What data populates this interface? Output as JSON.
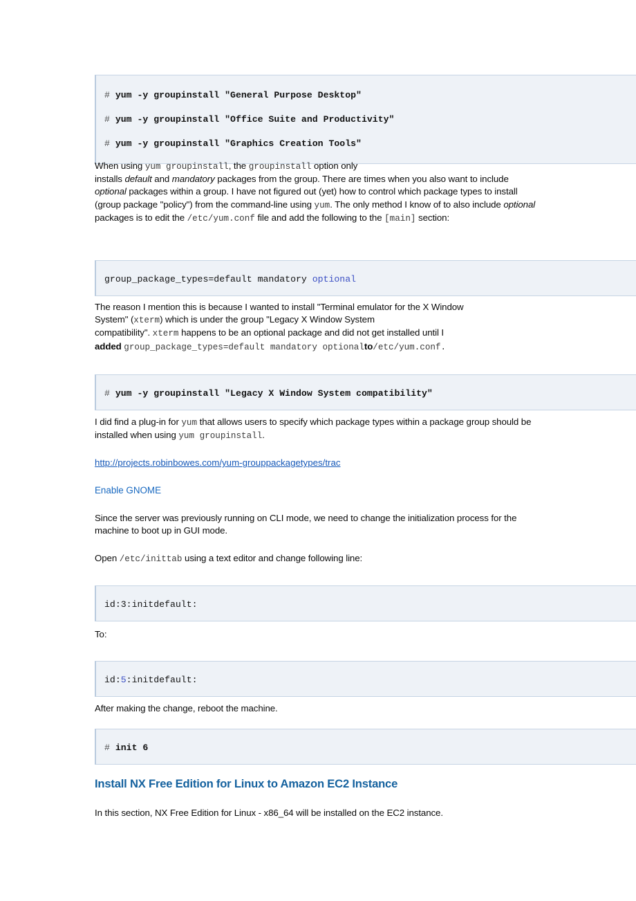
{
  "document": {
    "blocks": [
      {
        "kind": "code-block-commands",
        "lines": [
          {
            "prompt": "#",
            "command": "yum -y groupinstall \"General Purpose Desktop\""
          },
          {
            "prompt": "#",
            "command": "yum -y groupinstall \"Office Suite and Productivity\""
          },
          {
            "prompt": "#",
            "command": "yum -y groupinstall \"Graphics Creation Tools\""
          }
        ]
      },
      {
        "kind": "paragraph",
        "id": "para_groupinstall",
        "segments": [
          {
            "type": "text",
            "text": "When using "
          },
          {
            "type": "code",
            "text": "yum groupinstall"
          },
          {
            "type": "text",
            "text": ", the "
          },
          {
            "type": "code",
            "text": "groupinstall"
          },
          {
            "type": "text",
            "text": " option only"
          },
          {
            "type": "break"
          },
          {
            "type": "text",
            "text": "installs "
          },
          {
            "type": "italic",
            "text": "default"
          },
          {
            "type": "text",
            "text": " and "
          },
          {
            "type": "italic",
            "text": "mandatory"
          },
          {
            "type": "text",
            "text": " packages from the group. There are times when you also want to include "
          },
          {
            "type": "italic",
            "text": "optional"
          },
          {
            "type": "text",
            "text": " packages within a group. I have not figured out (yet) how to control which package types to install (group package \"policy\") from the command-line using "
          },
          {
            "type": "code",
            "text": "yum"
          },
          {
            "type": "text",
            "text": ". The only method I know of to also include "
          },
          {
            "type": "italic",
            "text": "optional"
          },
          {
            "type": "text",
            "text": " packages is to edit the "
          },
          {
            "type": "code",
            "text": "/etc/yum.conf"
          },
          {
            "type": "text",
            "text": " file and add the following to the "
          },
          {
            "type": "code",
            "text": "[main]"
          },
          {
            "type": "text",
            "text": " section:"
          }
        ]
      },
      {
        "kind": "code-block-config",
        "id": "code_group_package_types",
        "plain_prefix": "group_package_types=default mandatory ",
        "highlight": "optional",
        "highlight_color": "#3b4fc4"
      },
      {
        "kind": "paragraph",
        "id": "para_xterm",
        "segments": [
          {
            "type": "text",
            "text": "The reason I mention this is because I wanted to install \"Terminal emulator for the X Window System\" ("
          },
          {
            "type": "code",
            "text": "xterm"
          },
          {
            "type": "text",
            "text": ") which is under the group \"Legacy X Window System"
          },
          {
            "type": "break"
          },
          {
            "type": "text",
            "text": "compatibility\". "
          },
          {
            "type": "code",
            "text": "xterm"
          },
          {
            "type": "text",
            "text": " happens to be an optional package and did not get installed until I added "
          },
          {
            "type": "code",
            "text": "group_package_types=default mandatory optional"
          },
          {
            "type": "text",
            "text": " "
          },
          {
            "type": "bold",
            "text": "to"
          },
          {
            "type": "code",
            "text": "/etc/yum.conf."
          }
        ]
      },
      {
        "kind": "code-block-commands",
        "id": "code_legacy_x",
        "lines": [
          {
            "prompt": "#",
            "command": "yum -y groupinstall \"Legacy X Window System compatibility\""
          }
        ]
      },
      {
        "kind": "paragraph",
        "id": "para_plugin",
        "segments": [
          {
            "type": "text",
            "text": "I did find a plug-in for "
          },
          {
            "type": "code",
            "text": "yum"
          },
          {
            "type": "text",
            "text": " that allows users to specify which package types within a package group should be installed when using "
          },
          {
            "type": "code",
            "text": "yum groupinstall"
          },
          {
            "type": "text",
            "text": "."
          }
        ]
      },
      {
        "kind": "link",
        "id": "link_yum_grouppackagetypes",
        "text": "http://projects.robinbowes.com/yum-grouppackagetypes/trac"
      },
      {
        "kind": "subheading",
        "id": "heading_enable_gnome",
        "text": "Enable GNOME"
      },
      {
        "kind": "paragraph",
        "id": "para_cli_mode",
        "segments": [
          {
            "type": "text",
            "text": "Since the server was previously running on CLI mode, we need to change the initialization process for the machine to boot up in GUI mode."
          }
        ]
      },
      {
        "kind": "paragraph",
        "id": "para_open_inittab",
        "segments": [
          {
            "type": "text",
            "text": "Open "
          },
          {
            "type": "code",
            "text": "/etc/inittab"
          },
          {
            "type": "text",
            "text": " using a text editor and change following line:"
          }
        ]
      },
      {
        "kind": "code-block-config",
        "id": "code_initdefault_3",
        "text": "id:3:initdefault:"
      },
      {
        "kind": "paragraph",
        "id": "para_to",
        "segments": [
          {
            "type": "text",
            "text": "To:"
          }
        ]
      },
      {
        "kind": "code-block-config",
        "id": "code_initdefault_5",
        "prefix": "id:",
        "highlight": "5",
        "suffix": ":initdefault:",
        "highlight_color": "#3b4fc4"
      },
      {
        "kind": "paragraph",
        "id": "para_reboot",
        "segments": [
          {
            "type": "text",
            "text": "After making the change, reboot the machine."
          }
        ]
      },
      {
        "kind": "code-block-commands",
        "id": "code_init6",
        "lines": [
          {
            "prompt": "#",
            "command": "init 6"
          }
        ]
      },
      {
        "kind": "heading",
        "id": "heading_install_nx",
        "text": "Install NX Free Edition for Linux to Amazon EC2 Instance"
      },
      {
        "kind": "paragraph",
        "id": "para_nx_intro",
        "segments": [
          {
            "type": "text",
            "text": "In this section, NX Free Edition for Linux - x86_64 will be installed on the EC2 instance."
          }
        ]
      }
    ]
  },
  "text": {
    "code1_line1_prompt": "#",
    "code1_line1": "yum -y groupinstall \"General Purpose Desktop\"",
    "code1_line2_prompt": "#",
    "code1_line2": "yum -y groupinstall \"Office Suite and Productivity\"",
    "code1_line3_prompt": "#",
    "code1_line3": "yum -y groupinstall \"Graphics Creation Tools\"",
    "p1_a": "When using ",
    "p1_code1": "yum groupinstall",
    "p1_b": ", the ",
    "p1_code2": "groupinstall",
    "p1_c": " option only",
    "p1_d": "installs ",
    "p1_i1": "default",
    "p1_e": " and ",
    "p1_i2": "mandatory",
    "p1_f": " packages from the group. There are times when you also want to include ",
    "p1_i3": "optional",
    "p1_g": " packages within a group. I have not figured out (yet) how to control which package types to install (group package \"policy\") from the command-line using ",
    "p1_code3": "yum",
    "p1_h": ". The only method I know of to also include ",
    "p1_i4": "optional",
    "p1_j": " packages is to edit the ",
    "p1_code4": "/etc/yum.conf",
    "p1_k": " file and add the following to the ",
    "p1_code5": "[main]",
    "p1_l": " section:",
    "code2_plain": "group_package_types=default mandatory ",
    "code2_kw": "optional",
    "p2_a": "The reason I mention this is because I wanted to install \"Terminal emulator for the X Window",
    "p2_b": "System\" (",
    "p2_code1": "xterm",
    "p2_c": ") which is under the group \"Legacy X Window System",
    "p2_d": "compatibility\". ",
    "p2_code2": "xterm",
    "p2_e": " happens to be an optional package and did not get installed until I",
    "p2_f": "added ",
    "p2_code3": "group_package_types=default mandatory optional",
    "p2_bold": "to",
    "p2_code4": "/etc/yum.conf.",
    "code3_prompt": "#",
    "code3_line": "yum -y groupinstall \"Legacy X Window System compatibility\"",
    "p3_a": "I did find a plug-in for ",
    "p3_code1": "yum",
    "p3_b": " that allows users to specify which package types within a package group should be installed when using ",
    "p3_code2": "yum groupinstall",
    "p3_c": ".",
    "link_text": "http://projects.robinbowes.com/yum-grouppackagetypes/trac",
    "heading_gnome": "Enable GNOME",
    "p4": "Since the server was previously running on CLI mode, we need to change the initialization process for the machine to boot up in GUI mode.",
    "p5_a": "Open ",
    "p5_code": "/etc/inittab",
    "p5_b": " using a text editor and change following line:",
    "code4": "id:3:initdefault:",
    "p6": "To:",
    "code5_prefix": "id:",
    "code5_kw": "5",
    "code5_suffix": ":initdefault:",
    "p7": "After making the change, reboot the machine.",
    "code6_prompt": "#",
    "code6_line": "init 6",
    "heading_nx": "Install NX Free Edition for Linux to Amazon EC2 Instance",
    "p8": "In this section, NX Free Edition for Linux - x86_64 will be installed on the EC2 instance."
  },
  "colors": {
    "code_block_bg": "#eef2f7",
    "code_block_border": "#c6d4e4",
    "keyword_blue": "#3b4fc4",
    "link_blue": "#1558b8",
    "subheading_blue": "#1768c0",
    "heading_blue": "#14619e",
    "body_text": "#0a0a0a",
    "inline_code": "#3a3a3a",
    "page_bg": "#ffffff"
  }
}
